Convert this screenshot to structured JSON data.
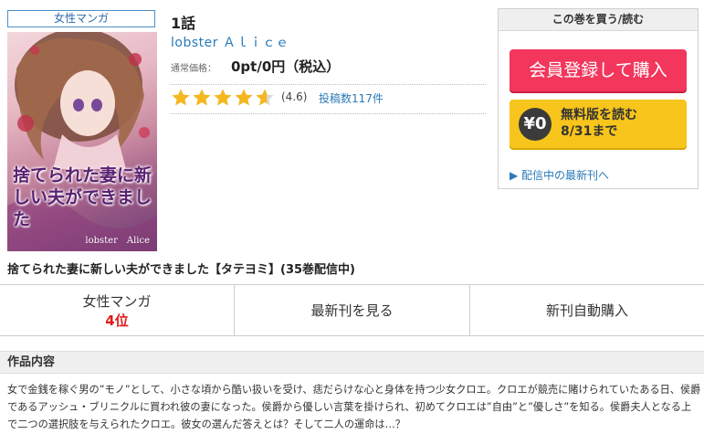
{
  "genre_tag": "女性マンガ",
  "cover": {
    "title": "捨てられた妻に新しい夫ができました",
    "author": "lobster　Alice"
  },
  "episode_title": "1話",
  "author": "lobster Ａｌｉｃｅ",
  "price": {
    "label": "通常価格：",
    "value": "0pt/0円（税込）"
  },
  "rating": {
    "stars": 4.6,
    "value_text": "(4.6)",
    "reviews_text": "投稿数117件"
  },
  "purchase": {
    "header": "この巻を買う/読む",
    "register_button": "会員登録して購入",
    "free_badge": "¥0",
    "free_line1": "無料版を読む",
    "free_line2": "8/31まで",
    "latest_link": "▶ 配信中の最新刊へ"
  },
  "series_title": "捨てられた妻に新しい夫ができました【タテヨミ】(35巻配信中)",
  "actions": {
    "ranking_genre": "女性マンガ",
    "ranking_value": "4位",
    "latest_button": "最新刊を見る",
    "auto_purchase_button": "新刊自動購入"
  },
  "description": {
    "heading": "作品内容",
    "text": "女で金銭を稼ぐ男の”モノ”として、小さな頃から酷い扱いを受け、痣だらけな心と身体を持つ少女クロエ。クロエが競売に賭けられていたある日、侯爵であるアッシュ・ブリニクルに買われ彼の妻になった。侯爵から優しい言葉を掛けられ、初めてクロエは”自由”と”優しさ”を知る。侯爵夫人となる上で二つの選択肢を与えられたクロエ。彼女の選んだ答えとは？そして二人の運命は…？"
  },
  "colors": {
    "accent_blue": "#2a7ab8",
    "register_red": "#f2365c",
    "free_yellow": "#f7c51b",
    "rank_red": "#e01b1b",
    "star_gold": "#f5b71e"
  }
}
